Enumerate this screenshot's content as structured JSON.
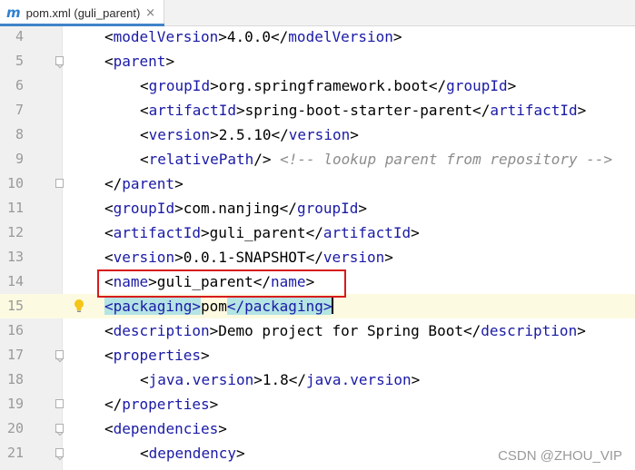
{
  "tab": {
    "icon": "m",
    "title": "pom.xml (guli_parent)",
    "close": "×"
  },
  "lines": [
    {
      "num": "4",
      "indent": 1,
      "fold": "",
      "parts": [
        {
          "t": "<",
          "c": "lt"
        },
        {
          "t": "modelVersion",
          "c": "tag"
        },
        {
          "t": ">4.0.0</",
          "c": ""
        },
        {
          "t": "modelVersion",
          "c": "tag"
        },
        {
          "t": ">",
          "c": ""
        }
      ]
    },
    {
      "num": "5",
      "indent": 1,
      "fold": "open",
      "parts": [
        {
          "t": "<",
          "c": ""
        },
        {
          "t": "parent",
          "c": "tag"
        },
        {
          "t": ">",
          "c": ""
        }
      ]
    },
    {
      "num": "6",
      "indent": 2,
      "fold": "",
      "parts": [
        {
          "t": "<",
          "c": ""
        },
        {
          "t": "groupId",
          "c": "tag"
        },
        {
          "t": ">org.springframework.boot</",
          "c": ""
        },
        {
          "t": "groupId",
          "c": "tag"
        },
        {
          "t": ">",
          "c": ""
        }
      ]
    },
    {
      "num": "7",
      "indent": 2,
      "fold": "",
      "parts": [
        {
          "t": "<",
          "c": ""
        },
        {
          "t": "artifactId",
          "c": "tag"
        },
        {
          "t": ">spring-boot-starter-parent</",
          "c": ""
        },
        {
          "t": "artifactId",
          "c": "tag"
        },
        {
          "t": ">",
          "c": ""
        }
      ]
    },
    {
      "num": "8",
      "indent": 2,
      "fold": "",
      "parts": [
        {
          "t": "<",
          "c": ""
        },
        {
          "t": "version",
          "c": "tag"
        },
        {
          "t": ">2.5.10</",
          "c": ""
        },
        {
          "t": "version",
          "c": "tag"
        },
        {
          "t": ">",
          "c": ""
        }
      ]
    },
    {
      "num": "9",
      "indent": 2,
      "fold": "",
      "parts": [
        {
          "t": "<",
          "c": ""
        },
        {
          "t": "relativePath",
          "c": "tag"
        },
        {
          "t": "/> ",
          "c": ""
        },
        {
          "t": "<!-- lookup parent from repository -->",
          "c": "comment"
        }
      ]
    },
    {
      "num": "10",
      "indent": 1,
      "fold": "close",
      "parts": [
        {
          "t": "</",
          "c": ""
        },
        {
          "t": "parent",
          "c": "tag"
        },
        {
          "t": ">",
          "c": ""
        }
      ]
    },
    {
      "num": "11",
      "indent": 1,
      "fold": "",
      "parts": [
        {
          "t": "<",
          "c": ""
        },
        {
          "t": "groupId",
          "c": "tag"
        },
        {
          "t": ">com.nanjing</",
          "c": ""
        },
        {
          "t": "groupId",
          "c": "tag"
        },
        {
          "t": ">",
          "c": ""
        }
      ]
    },
    {
      "num": "12",
      "indent": 1,
      "fold": "",
      "parts": [
        {
          "t": "<",
          "c": ""
        },
        {
          "t": "artifactId",
          "c": "tag"
        },
        {
          "t": ">guli_parent</",
          "c": ""
        },
        {
          "t": "artifactId",
          "c": "tag"
        },
        {
          "t": ">",
          "c": ""
        }
      ]
    },
    {
      "num": "13",
      "indent": 1,
      "fold": "",
      "parts": [
        {
          "t": "<",
          "c": ""
        },
        {
          "t": "version",
          "c": "tag"
        },
        {
          "t": ">0.0.1-SNAPSHOT</",
          "c": ""
        },
        {
          "t": "version",
          "c": "tag"
        },
        {
          "t": ">",
          "c": ""
        }
      ]
    },
    {
      "num": "14",
      "indent": 1,
      "fold": "",
      "parts": [
        {
          "t": "<",
          "c": ""
        },
        {
          "t": "name",
          "c": "tag"
        },
        {
          "t": ">guli_parent</",
          "c": ""
        },
        {
          "t": "name",
          "c": "tag"
        },
        {
          "t": ">",
          "c": ""
        }
      ]
    },
    {
      "num": "15",
      "indent": 1,
      "fold": "",
      "current": true,
      "bulb": true,
      "parts": [
        {
          "t": "<packaging>",
          "c": "tag hl"
        },
        {
          "t": "pom",
          "c": ""
        },
        {
          "t": "</packaging>",
          "c": "tag hl"
        },
        {
          "t": "",
          "c": "caret"
        }
      ]
    },
    {
      "num": "16",
      "indent": 1,
      "fold": "",
      "parts": [
        {
          "t": "<",
          "c": ""
        },
        {
          "t": "description",
          "c": "tag"
        },
        {
          "t": ">Demo project for Spring Boot</",
          "c": ""
        },
        {
          "t": "description",
          "c": "tag"
        },
        {
          "t": ">",
          "c": ""
        }
      ]
    },
    {
      "num": "17",
      "indent": 1,
      "fold": "open",
      "parts": [
        {
          "t": "<",
          "c": ""
        },
        {
          "t": "properties",
          "c": "tag"
        },
        {
          "t": ">",
          "c": ""
        }
      ]
    },
    {
      "num": "18",
      "indent": 2,
      "fold": "",
      "parts": [
        {
          "t": "<",
          "c": ""
        },
        {
          "t": "java.version",
          "c": "tag"
        },
        {
          "t": ">1.8</",
          "c": ""
        },
        {
          "t": "java.version",
          "c": "tag"
        },
        {
          "t": ">",
          "c": ""
        }
      ]
    },
    {
      "num": "19",
      "indent": 1,
      "fold": "close",
      "parts": [
        {
          "t": "</",
          "c": ""
        },
        {
          "t": "properties",
          "c": "tag"
        },
        {
          "t": ">",
          "c": ""
        }
      ]
    },
    {
      "num": "20",
      "indent": 1,
      "fold": "open",
      "parts": [
        {
          "t": "<",
          "c": ""
        },
        {
          "t": "dependencies",
          "c": "tag"
        },
        {
          "t": ">",
          "c": ""
        }
      ]
    },
    {
      "num": "21",
      "indent": 2,
      "fold": "open",
      "parts": [
        {
          "t": "<",
          "c": ""
        },
        {
          "t": "dependency",
          "c": "tag"
        },
        {
          "t": ">",
          "c": ""
        }
      ]
    }
  ],
  "watermark": "CSDN @ZHOU_VIP"
}
